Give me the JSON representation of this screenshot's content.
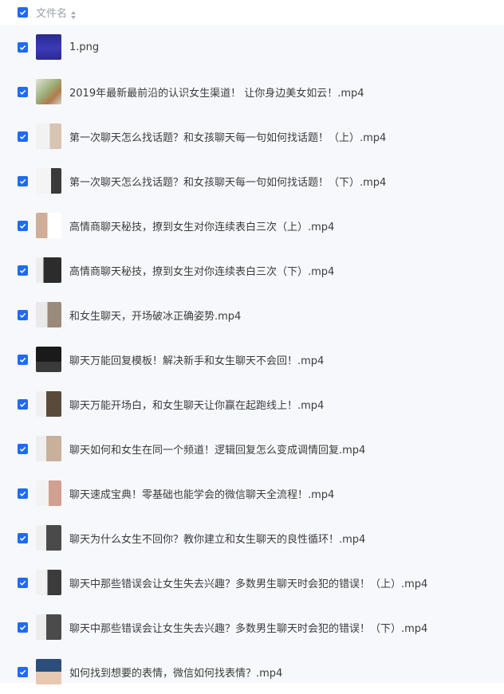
{
  "header": {
    "column_label": "文件名"
  },
  "files": [
    {
      "name": "1.png",
      "thumb": "blue-banner"
    },
    {
      "name": "2019年最新最前沿的认识女生渠道！ 让你身边美女如云！.mp4",
      "thumb": "plant"
    },
    {
      "name": "第一次聊天怎么找话题？和女孩聊天每一句如何找话题！（上）.mp4",
      "thumb": "video-a"
    },
    {
      "name": "第一次聊天怎么找话题？和女孩聊天每一句如何找话题！（下）.mp4",
      "thumb": "video-b"
    },
    {
      "name": "高情商聊天秘技，撩到女生对你连续表白三次（上）.mp4",
      "thumb": "video-c"
    },
    {
      "name": "高情商聊天秘技，撩到女生对你连续表白三次（下）.mp4",
      "thumb": "video-d"
    },
    {
      "name": "和女生聊天，开场破冰正确姿势.mp4",
      "thumb": "video-e"
    },
    {
      "name": "聊天万能回复模板！解决新手和女生聊天不会回！.mp4",
      "thumb": "video-f"
    },
    {
      "name": "聊天万能开场白，和女生聊天让你赢在起跑线上！.mp4",
      "thumb": "video-g"
    },
    {
      "name": "聊天如何和女生在同一个频道！逻辑回复怎么变成调情回复.mp4",
      "thumb": "video-h"
    },
    {
      "name": "聊天速成宝典！零基础也能学会的微信聊天全流程！.mp4",
      "thumb": "video-i"
    },
    {
      "name": "聊天为什么女生不回你？教你建立和女生聊天的良性循环！.mp4",
      "thumb": "video-j"
    },
    {
      "name": "聊天中那些错误会让女生失去兴趣？多数男生聊天时会犯的错误！（上）.mp4",
      "thumb": "video-k"
    },
    {
      "name": "聊天中那些错误会让女生失去兴趣？多数男生聊天时会犯的错误！（下）.mp4",
      "thumb": "video-l"
    },
    {
      "name": "如何找到想要的表情，微信如何找表情？.mp4",
      "thumb": "video-m"
    }
  ]
}
